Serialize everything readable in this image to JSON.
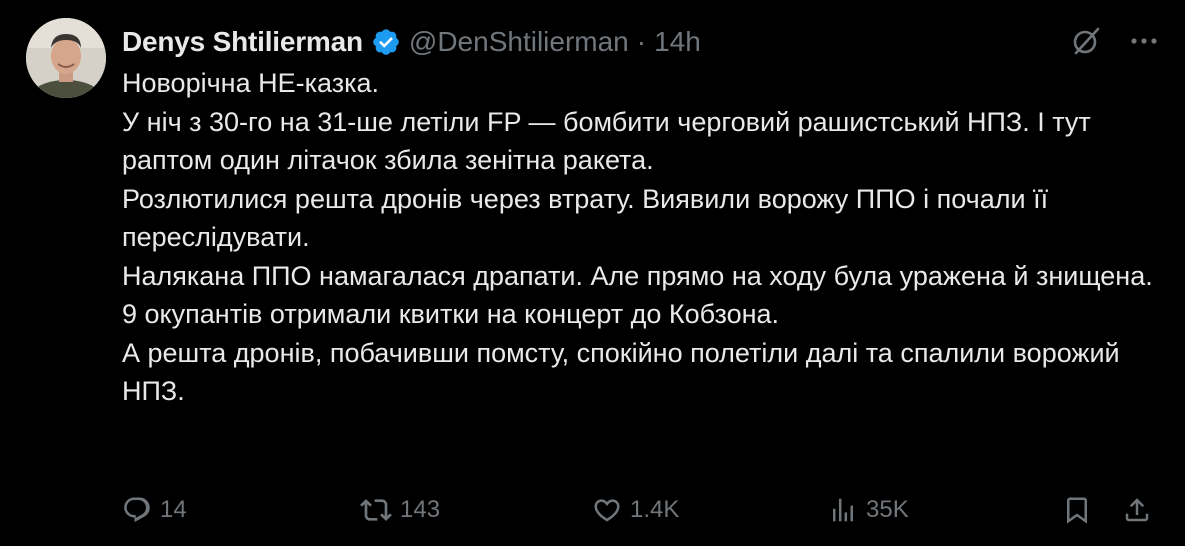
{
  "author": {
    "display_name": "Denys Shtilierman",
    "handle": "@DenShtilierman",
    "separator": "·",
    "time": "14h",
    "verified": true,
    "verified_color": "#1d9bf0"
  },
  "icons": {
    "grok": "grok-slash-icon",
    "more": "more-horizontal-icon",
    "reply": "reply-bubble-icon",
    "retweet": "retweet-icon",
    "like": "heart-icon",
    "views": "views-bar-chart-icon",
    "bookmark": "bookmark-icon",
    "share": "share-upload-icon"
  },
  "tweet": {
    "lines": [
      "Новорічна НЕ-казка.",
      "У ніч з 30-го на 31-ше летіли FP — бомбити черговий рашистський НПЗ. І тут раптом один літачок збила зенітна ракета.",
      "Розлютилися решта дронів через втрату. Виявили ворожу ППО і почали її переслідувати.",
      "Налякана ППО намагалася драпати. Але прямо на ходу була уражена й знищена.",
      "9 окупантів отримали квитки на концерт до Кобзона.",
      "А решта дронів, побачивши помсту, спокійно полетіли далі та спалили ворожий НПЗ."
    ]
  },
  "stats": {
    "replies": "14",
    "retweets": "143",
    "likes": "1.4K",
    "views": "35K"
  },
  "colors": {
    "background": "#000000",
    "text_primary": "#e7e9ea",
    "text_secondary": "#71767b"
  }
}
